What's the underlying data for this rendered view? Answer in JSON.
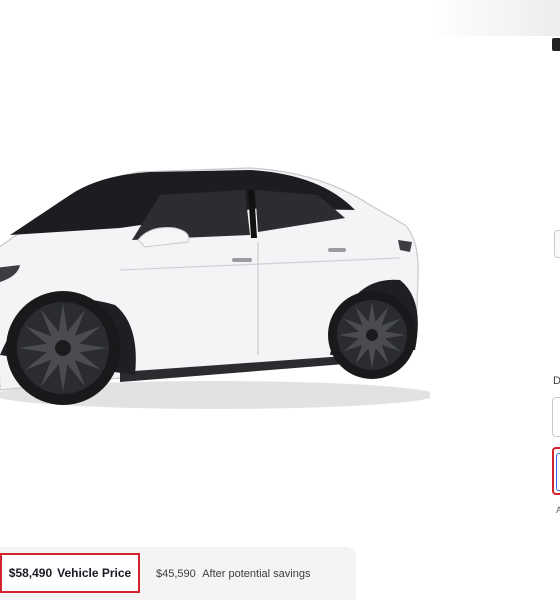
{
  "product": {
    "image_alt": "Tesla Model Y Performance in Pearl White",
    "paint_color": "#f4f5f6",
    "wheel_color": "#2a2c30"
  },
  "pricing": {
    "vehicle_price": "$58,490",
    "vehicle_price_label": "Vehicle Price",
    "savings_price": "$45,590",
    "savings_label": "After potential savings"
  },
  "sidebar": {
    "field_label_initial": "D",
    "note_initial": "A"
  },
  "colors": {
    "highlight_red": "#d3232f",
    "focus_blue": "#3e6ae1",
    "bar_background": "#f4f4f4"
  }
}
